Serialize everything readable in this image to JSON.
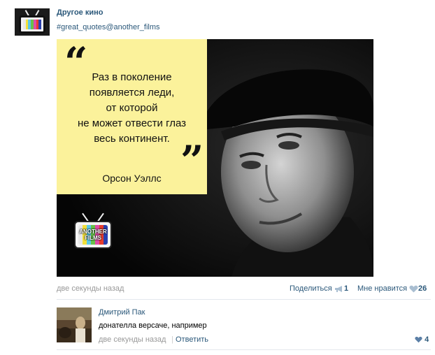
{
  "post": {
    "group_name": "Другое кино",
    "hashtag": "#great_quotes@another_films",
    "quote": {
      "text": "Раз в поколение\nпоявляется леди,\nот которой\nне может отвести глаз\nвесь континент.",
      "author": "Орсон Уэллс"
    },
    "logo_text": "ANOTHER FILMS",
    "time": "две секунды назад",
    "share_label": "Поделиться",
    "share_count": "1",
    "like_label": "Мне нравится",
    "like_count": "26",
    "colors": {
      "link": "#2b587a",
      "muted": "#999999",
      "quote_bg": "#fbf29b"
    },
    "icons": {
      "share": "megaphone-icon",
      "like": "heart-icon"
    }
  },
  "comment": {
    "author": "Дмитрий Пак",
    "text": "донателла версаче, например",
    "time": "две секунды назад",
    "reply_label": "Ответить",
    "like_count": "4"
  }
}
